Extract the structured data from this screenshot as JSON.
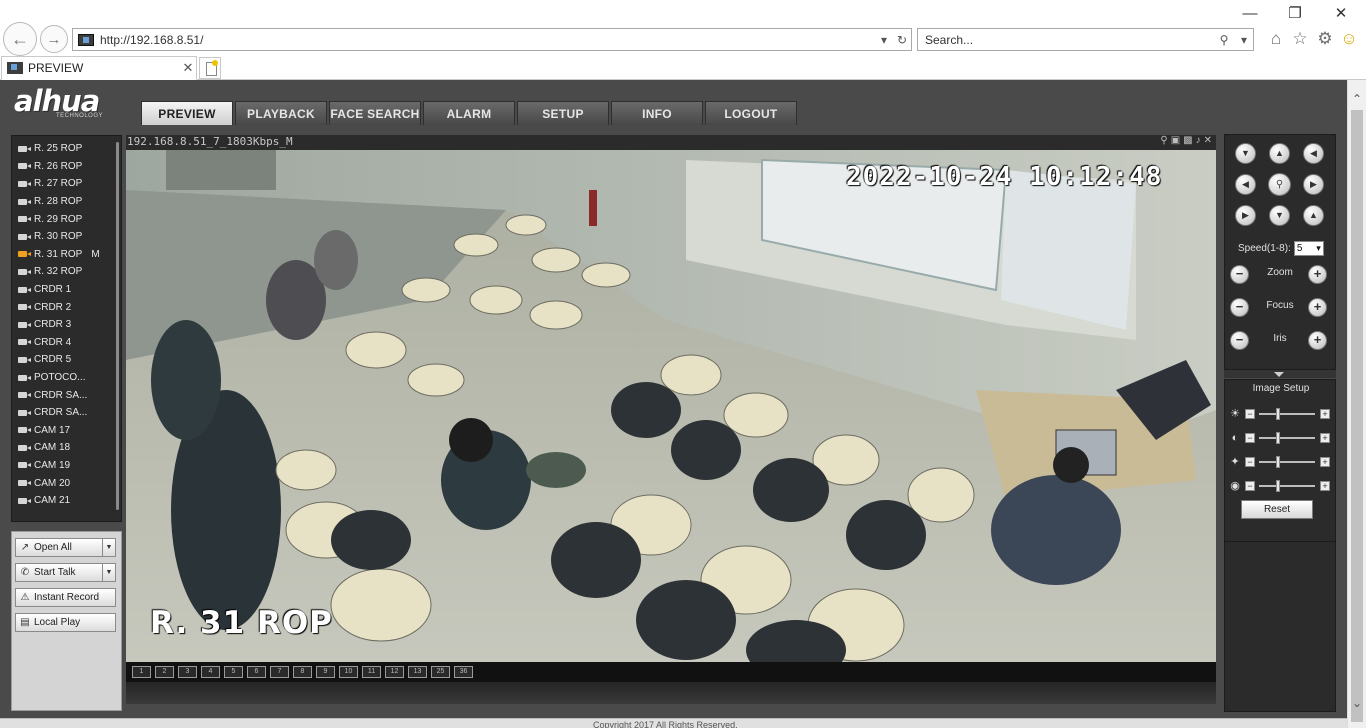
{
  "browser": {
    "url": "http://192.168.8.51/",
    "search_placeholder": "Search...",
    "tab_title": "PREVIEW",
    "icons": [
      "back-icon",
      "forward-icon",
      "home-icon",
      "favorites-star-icon",
      "settings-gear-icon",
      "smiley-feedback-icon"
    ]
  },
  "app": {
    "logo": "alhua",
    "logo_sub": "TECHNOLOGY",
    "nav_tabs": [
      "PREVIEW",
      "PLAYBACK",
      "FACE SEARCH",
      "ALARM",
      "SETUP",
      "INFO",
      "LOGOUT"
    ],
    "active_tab": "PREVIEW",
    "cameras": [
      "R. 25 ROP",
      "R. 26 ROP",
      "R. 27 ROP",
      "R. 28 ROP",
      "R. 29 ROP",
      "R. 30 ROP",
      "R. 31 ROP",
      "R. 32 ROP",
      "CRDR 1",
      "CRDR 2",
      "CRDR 3",
      "CRDR 4",
      "CRDR 5",
      "POTOCO...",
      "CRDR SA...",
      "CRDR SA...",
      "CAM 17",
      "CAM 18",
      "CAM 19",
      "CAM 20",
      "CAM 21"
    ],
    "active_camera_index": 6,
    "active_camera_mark": "M",
    "actions": {
      "open_all": "Open All",
      "start_talk": "Start Talk",
      "instant_record": "Instant Record",
      "local_play": "Local Play"
    },
    "video": {
      "info": "192.168.8.51_7_1803Kbps_M",
      "osd_time": "2022-10-24 10:12:48",
      "osd_name": "R. 31 ROP"
    },
    "layout_buttons": [
      "1",
      "2",
      "3",
      "4",
      "5",
      "6",
      "7",
      "8",
      "9",
      "10",
      "11",
      "12",
      "13",
      "25",
      "36"
    ],
    "ptz": {
      "speed_label": "Speed(1-8):",
      "speed_value": "5",
      "zoom": "Zoom",
      "focus": "Focus",
      "iris": "Iris"
    },
    "image_setup": {
      "title": "Image Setup",
      "reset": "Reset",
      "rows": [
        "brightness-icon",
        "contrast-icon",
        "saturation-icon",
        "hue-icon"
      ]
    },
    "footer": "Copyright 2017 All Rights Reserved."
  },
  "colors": {
    "app_bg": "#4a4a4a",
    "panel_bg": "#2b2b2b",
    "active_camera": "#f0a020"
  }
}
